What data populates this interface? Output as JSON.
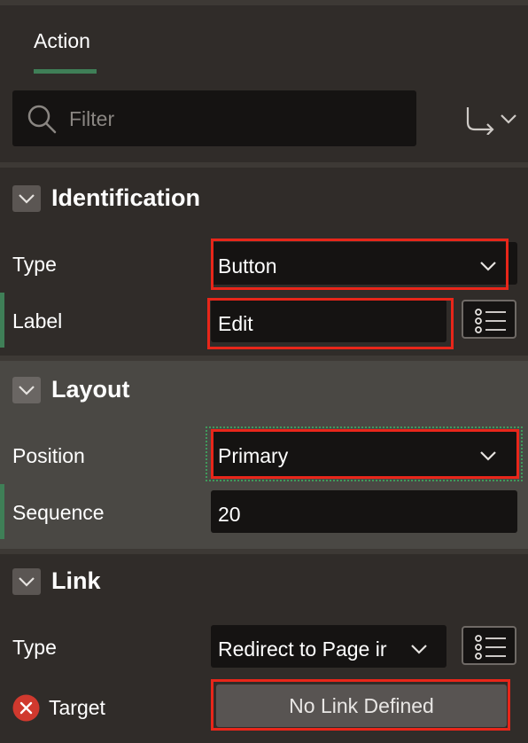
{
  "tabs": [
    {
      "label": "Action"
    }
  ],
  "search": {
    "placeholder": "Filter"
  },
  "sections": {
    "identification": {
      "title": "Identification",
      "type_label": "Type",
      "type_value": "Button",
      "label_label": "Label",
      "label_value": "Edit"
    },
    "layout": {
      "title": "Layout",
      "position_label": "Position",
      "position_value": "Primary",
      "sequence_label": "Sequence",
      "sequence_value": "20"
    },
    "link": {
      "title": "Link",
      "type_label": "Type",
      "type_value": "Redirect to Page ir",
      "target_label": "Target",
      "target_button": "No Link Defined"
    }
  },
  "colors": {
    "panel_bg": "#302c29",
    "layout_bg": "#4a4844",
    "field_bg": "#151312",
    "accent_green": "#3f7f57",
    "highlight_red": "#e8261a",
    "error_red": "#d0392e"
  },
  "icons": [
    "search-icon",
    "goto-arrow-icon",
    "chevron-down-icon",
    "list-icon",
    "error-icon"
  ]
}
